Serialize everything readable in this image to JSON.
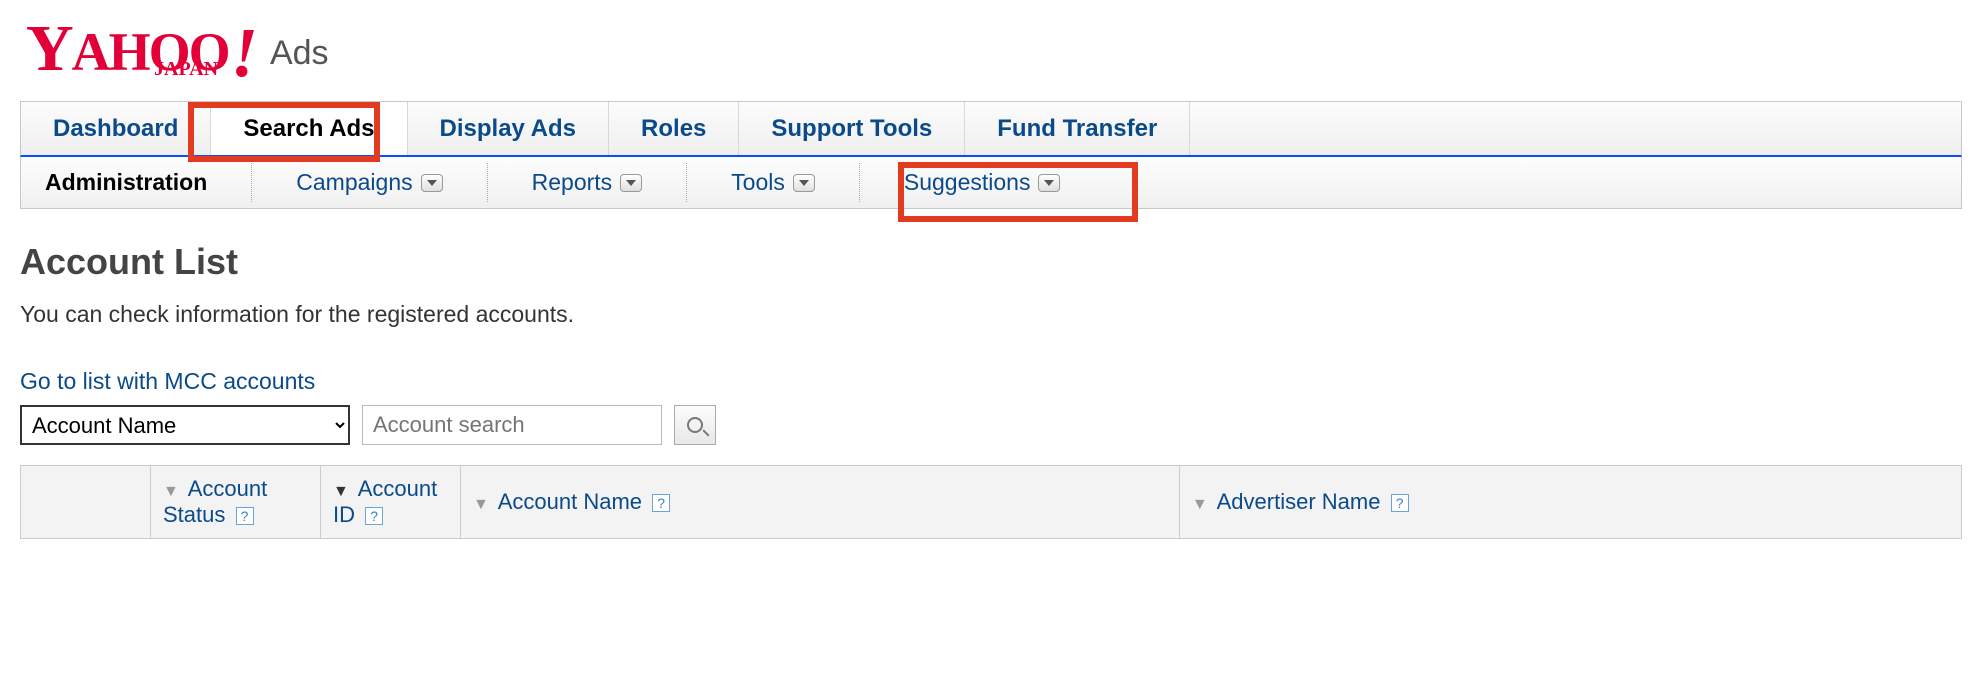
{
  "logo": {
    "text_main": "YAHOO",
    "text_bang": "!",
    "text_sub": "JAPAN",
    "text_ads": "Ads"
  },
  "primary_tabs": [
    {
      "label": "Dashboard",
      "active": false
    },
    {
      "label": "Search Ads",
      "active": true
    },
    {
      "label": "Display Ads",
      "active": false
    },
    {
      "label": "Roles",
      "active": false
    },
    {
      "label": "Support Tools",
      "active": false
    },
    {
      "label": "Fund Transfer",
      "active": false
    }
  ],
  "secondary_tabs": {
    "admin": "Administration",
    "campaigns": "Campaigns",
    "reports": "Reports",
    "tools": "Tools",
    "suggestions": "Suggestions"
  },
  "page": {
    "title": "Account List",
    "description": "You can check information for the registered accounts.",
    "mcc_link": "Go to list with MCC accounts"
  },
  "search": {
    "filter_selected": "Account Name",
    "placeholder": "Account search"
  },
  "table_headers": {
    "status": "Account Status",
    "id": "Account ID",
    "name": "Account Name",
    "advertiser": "Advertiser Name"
  }
}
